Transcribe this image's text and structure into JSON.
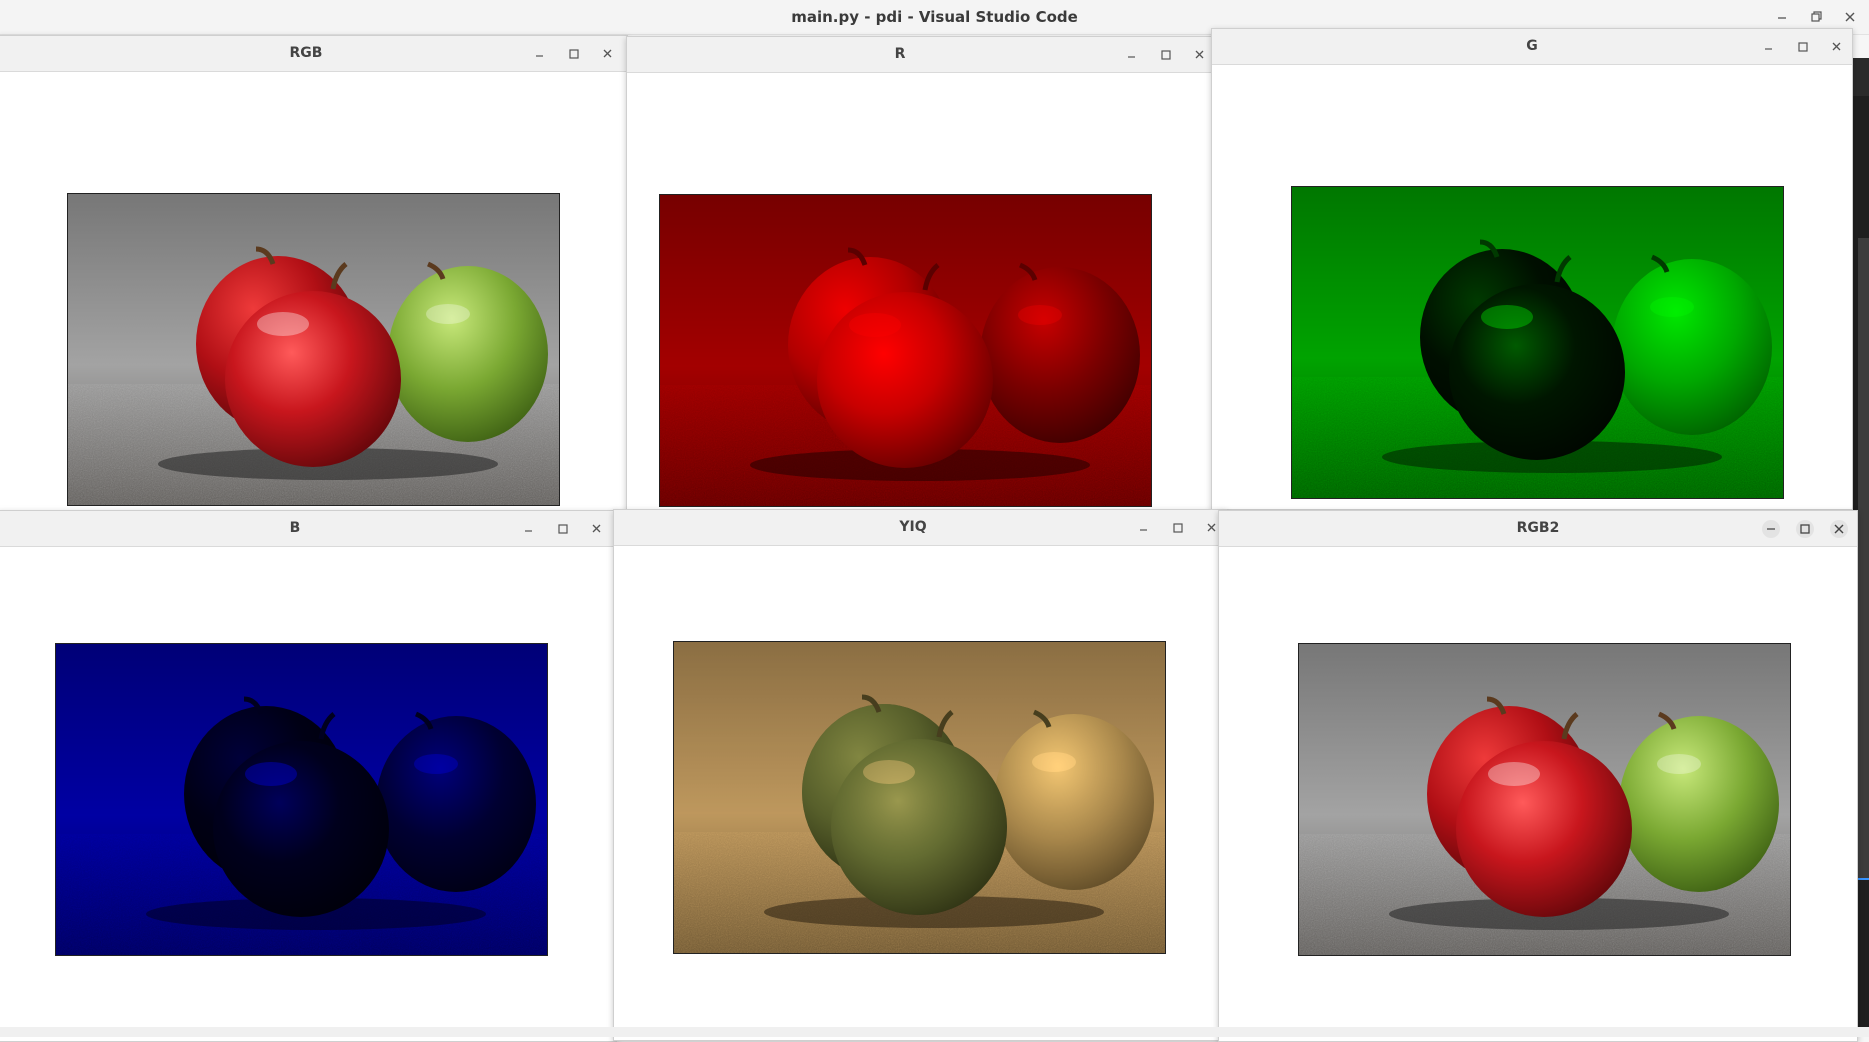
{
  "outer_window": {
    "title": "main.py - pdi - Visual Studio Code"
  },
  "windows": [
    {
      "title": "RGB",
      "filter": "rgb"
    },
    {
      "title": "R",
      "filter": "r"
    },
    {
      "title": "G",
      "filter": "g"
    },
    {
      "title": "B",
      "filter": "b"
    },
    {
      "title": "YIQ",
      "filter": "yiq"
    },
    {
      "title": "RGB2",
      "filter": "rgb"
    }
  ],
  "icons": {
    "minimize": "minimize-icon",
    "maximize": "maximize-icon",
    "close": "close-icon"
  },
  "colors": {
    "apple_red": "#c4141b",
    "apple_green": "#7aa832",
    "background_gray": "#8e8e8e",
    "ground_gray": "#6d6a67"
  }
}
